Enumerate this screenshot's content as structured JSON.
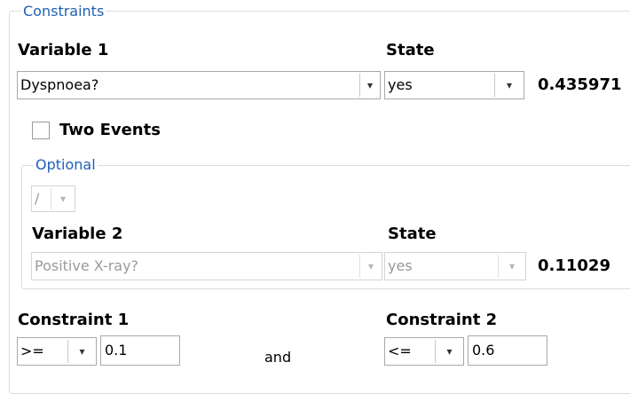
{
  "constraints": {
    "group_title": "Constraints",
    "variable1": {
      "label": "Variable 1",
      "value": "Dyspnoea?",
      "arrow": "▾"
    },
    "state1": {
      "label": "State",
      "value": "yes",
      "arrow": "▾",
      "probability": "0.435971"
    },
    "two_events": {
      "label": "Two Events",
      "checked": false
    },
    "optional": {
      "group_title": "Optional",
      "operator": {
        "value": "/",
        "arrow": "▾"
      },
      "variable2": {
        "label": "Variable 2",
        "value": "Positive X-ray?",
        "arrow": "▾"
      },
      "state2": {
        "label": "State",
        "value": "yes",
        "arrow": "▾",
        "probability": "0.11029"
      }
    },
    "constraint1": {
      "label": "Constraint 1",
      "operator": ">=",
      "arrow": "▾",
      "value": "0.1"
    },
    "connector": "and",
    "constraint2": {
      "label": "Constraint 2",
      "operator": "<=",
      "arrow": "▾",
      "value": "0.6"
    }
  }
}
